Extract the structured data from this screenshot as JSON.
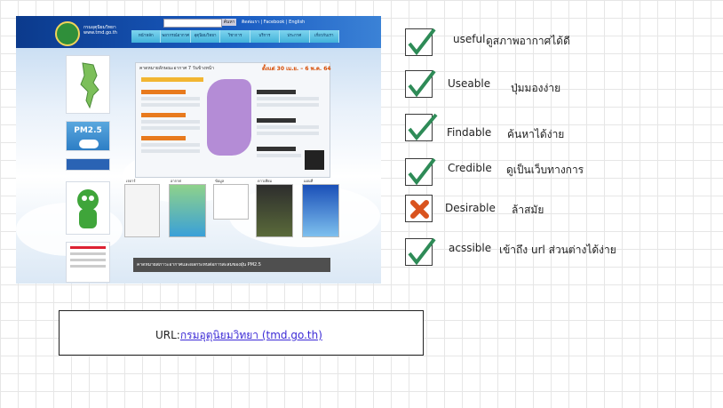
{
  "screenshot": {
    "logo_text": "กรมอุตุนิยมวิทยา",
    "logo_sub": "www.tmd.go.th",
    "search_button": "ค้นหา",
    "top_links": "ติดต่อเรา | Facebook | English",
    "nav": [
      "หน้าหลัก",
      "พยากรณ์อากาศ",
      "อุตุนิยมวิทยา",
      "วิชาการ",
      "บริการ",
      "ประกาศ",
      "เกี่ยวกับเรา"
    ],
    "banner_title": "คาดหมายลักษณะอากาศ 7 วันข้างหน้า",
    "banner_date": "ตั้งแต่ 30 เม.ย. – 6 พ.ค. 64",
    "thumb_captions": [
      "เรดาร์",
      "อากาศ",
      "ข้อมูล",
      "ดาวเทียม",
      "แผนที่"
    ],
    "pm_label": "PM2.5",
    "bottom_banner": "คาดหมายสภาวะอากาศและผลกระทบต่อการสะสมของฝุ่น PM2.5"
  },
  "criteria": [
    {
      "label": "useful",
      "note": "ดูสภาพอากาศได้ดี",
      "status": "check"
    },
    {
      "label": "Useable",
      "note": "ปุ่มมองง่าย",
      "status": "check"
    },
    {
      "label": "Findable",
      "note": "ค้นหาได้ง่าย",
      "status": "check"
    },
    {
      "label": "Credible",
      "note": "ดูเป็นเว็บทางการ",
      "status": "check"
    },
    {
      "label": "Desirable",
      "note": "ล้าสมัย",
      "status": "cross"
    },
    {
      "label": "acssible",
      "note": "เข้าถึง url ส่วนต่างได้ง่าย",
      "status": "check"
    }
  ],
  "colors": {
    "check": "#2e8b57",
    "cross": "#d9531e"
  },
  "url": {
    "prefix": "URL:",
    "link_text": "กรมอุตุนิยมวิทยา (tmd.go.th)"
  }
}
